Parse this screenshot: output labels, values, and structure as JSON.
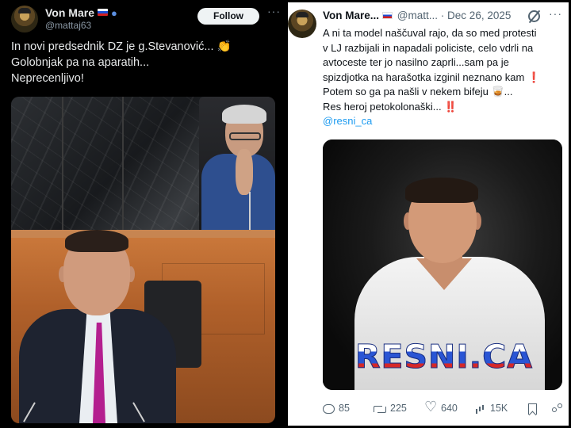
{
  "left_post": {
    "author_name": "Von Mare",
    "author_handle": "@mattaj63",
    "follow_label": "Follow",
    "more_label": "···",
    "text_lines": [
      "In novi predsednik DZ je g.Stevanović...",
      "Golobnjak pa na aparatih...",
      "Neprecenljivo!"
    ],
    "clap_emoji": "👏",
    "flag_icon": "slovenia-flag-icon",
    "badge_icon": "person-icon"
  },
  "right_post": {
    "author_name": "Von Mare",
    "author_handle": "@matt...",
    "separator": "·",
    "date": "Dec 26, 2025",
    "more_label": "···",
    "text_lines": [
      "A ni ta model naščuval rajo, da so med protesti",
      "v LJ razbijali in napadali policiste, celo vdrli na",
      "avtoceste ter jo nasilno zaprli...sam pa je",
      "spizdjotka na harašotka izginil neznano kam",
      "Potem so ga pa našli v nekem bifeju",
      "Res heroj petokolonaški..."
    ],
    "exclamation": "❗",
    "double_exclamation": "‼️",
    "glass_emoji": "🥃",
    "ellipsis_after_glass": "...",
    "mention": "@resni_ca",
    "watermark": "RESNI.CA",
    "actions": {
      "replies": "85",
      "reposts": "225",
      "likes": "640",
      "views": "15K"
    }
  }
}
